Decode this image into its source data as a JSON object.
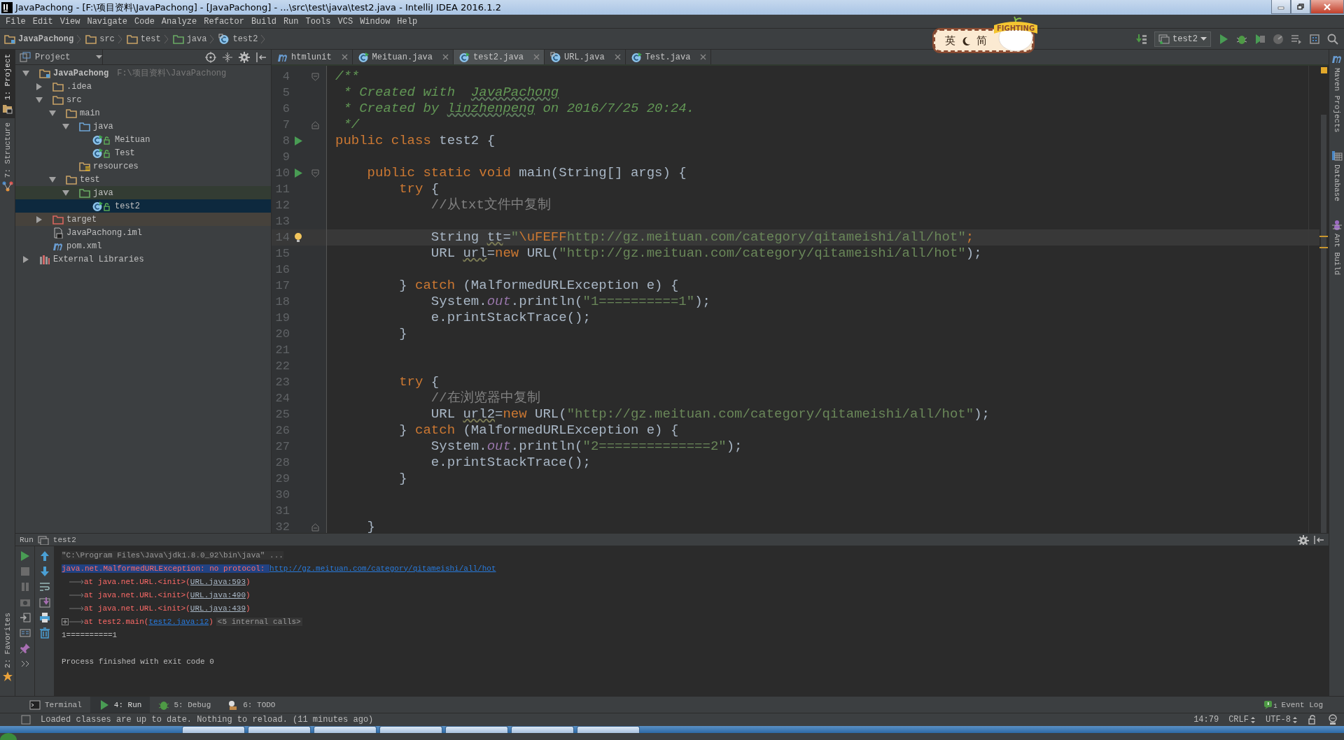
{
  "window": {
    "title": "JavaPachong - [F:\\项目资料\\JavaPachong] - [JavaPachong] - ...\\src\\test\\java\\test2.java - IntelliJ IDEA 2016.1.2"
  },
  "menu": [
    "File",
    "Edit",
    "View",
    "Navigate",
    "Code",
    "Analyze",
    "Refactor",
    "Build",
    "Run",
    "Tools",
    "VCS",
    "Window",
    "Help"
  ],
  "breadcrumbs": [
    {
      "label": "JavaPachong",
      "kind": "project"
    },
    {
      "label": "src",
      "kind": "folder"
    },
    {
      "label": "test",
      "kind": "folder"
    },
    {
      "label": "java",
      "kind": "test-folder"
    },
    {
      "label": "test2",
      "kind": "class"
    }
  ],
  "ime_badge": {
    "language": "英",
    "mode": "简",
    "mascot_text": "FIGHTING"
  },
  "run_config": {
    "label": "test2"
  },
  "left_strip": [
    {
      "label": "1: Project",
      "kind": "project",
      "selected": true
    },
    {
      "label": "7: Structure",
      "kind": "structure",
      "selected": false
    }
  ],
  "favorites_strip": {
    "label": "2: Favorites"
  },
  "right_strip": [
    {
      "label": "Maven Projects",
      "kind": "maven"
    },
    {
      "label": "Database",
      "kind": "database"
    },
    {
      "label": "Ant Build",
      "kind": "ant"
    }
  ],
  "project_panel": {
    "title": "Project",
    "tree": [
      {
        "label": "JavaPachong",
        "note": "F:\\项目资料\\JavaPachong",
        "kind": "project",
        "expanded": true,
        "selected": false,
        "children": [
          {
            "label": ".idea",
            "kind": "folder",
            "expanded": false,
            "selected": false
          },
          {
            "label": "src",
            "kind": "folder",
            "expanded": true,
            "selected": false,
            "children": [
              {
                "label": "main",
                "kind": "folder",
                "expanded": true,
                "selected": false,
                "children": [
                  {
                    "label": "java",
                    "kind": "source-folder",
                    "expanded": true,
                    "selected": false,
                    "children": [
                      {
                        "label": "Meituan",
                        "kind": "class",
                        "selected": false
                      },
                      {
                        "label": "Test",
                        "kind": "class",
                        "selected": false
                      }
                    ]
                  },
                  {
                    "label": "resources",
                    "kind": "resources-folder",
                    "selected": false
                  }
                ]
              },
              {
                "label": "test",
                "kind": "folder",
                "expanded": true,
                "selected": false,
                "children": [
                  {
                    "label": "java",
                    "kind": "test-folder",
                    "expanded": true,
                    "selected": false,
                    "children": [
                      {
                        "label": "test2",
                        "kind": "class",
                        "selected": true
                      }
                    ]
                  }
                ]
              }
            ]
          },
          {
            "label": "target",
            "kind": "excluded-folder",
            "expanded": false,
            "selected": false
          },
          {
            "label": "JavaPachong.iml",
            "kind": "iml",
            "selected": false
          },
          {
            "label": "pom.xml",
            "kind": "maven",
            "selected": false
          }
        ]
      },
      {
        "label": "External Libraries",
        "kind": "libraries",
        "expanded": false,
        "selected": false
      }
    ]
  },
  "tabs": [
    {
      "label": "htmlunit",
      "kind": "maven",
      "selected": false
    },
    {
      "label": "Meituan.java",
      "kind": "class",
      "selected": false
    },
    {
      "label": "test2.java",
      "kind": "class",
      "selected": true
    },
    {
      "label": "URL.java",
      "kind": "library-class",
      "selected": false
    },
    {
      "label": "Test.java",
      "kind": "class",
      "selected": false
    }
  ],
  "editor": {
    "lines": [
      {
        "number": "4",
        "run": false,
        "bulb": false,
        "fold_start": true,
        "fold_end": false,
        "current": false,
        "tokens": [
          {
            "kind": "doc",
            "text": "/**"
          }
        ]
      },
      {
        "number": "5",
        "run": false,
        "bulb": false,
        "fold_start": false,
        "fold_end": false,
        "current": false,
        "tokens": [
          {
            "kind": "doc",
            "text": " * Created with  "
          },
          {
            "kind": "doc-typo",
            "text": "JavaPachong"
          }
        ]
      },
      {
        "number": "6",
        "run": false,
        "bulb": false,
        "fold_start": false,
        "fold_end": false,
        "current": false,
        "tokens": [
          {
            "kind": "doc",
            "text": " * Created by "
          },
          {
            "kind": "doc-typo",
            "text": "linzhenpeng"
          },
          {
            "kind": "doc",
            "text": " on 2016/7/25 20:24."
          }
        ]
      },
      {
        "number": "7",
        "run": false,
        "bulb": false,
        "fold_start": false,
        "fold_end": true,
        "current": false,
        "tokens": [
          {
            "kind": "doc",
            "text": " */"
          }
        ]
      },
      {
        "number": "8",
        "run": true,
        "bulb": false,
        "fold_start": false,
        "fold_end": false,
        "current": false,
        "tokens": [
          {
            "kind": "kw",
            "text": "public class "
          },
          {
            "kind": "plain",
            "text": "test2 {"
          }
        ]
      },
      {
        "number": "9",
        "run": false,
        "bulb": false,
        "fold_start": false,
        "fold_end": false,
        "current": false
      },
      {
        "number": "10",
        "run": true,
        "bulb": false,
        "fold_start": true,
        "fold_end": false,
        "current": false,
        "tokens": [
          {
            "kind": "kw",
            "text": "    public static void "
          },
          {
            "kind": "plain",
            "text": "main(String[] args) {"
          }
        ]
      },
      {
        "number": "11",
        "run": false,
        "bulb": false,
        "fold_start": false,
        "fold_end": false,
        "current": false,
        "tokens": [
          {
            "kind": "kw",
            "text": "        try "
          },
          {
            "kind": "plain",
            "text": "{"
          }
        ]
      },
      {
        "number": "12",
        "run": false,
        "bulb": false,
        "fold_start": false,
        "fold_end": false,
        "current": false,
        "tokens": [
          {
            "kind": "cmt",
            "text": "            //从txt文件中复制"
          }
        ]
      },
      {
        "number": "13",
        "run": false,
        "bulb": false,
        "fold_start": false,
        "fold_end": false,
        "current": false
      },
      {
        "number": "14",
        "run": false,
        "bulb": true,
        "fold_start": false,
        "fold_end": false,
        "current": true,
        "tokens": [
          {
            "kind": "plain",
            "text": "            String "
          },
          {
            "kind": "unused",
            "text": "tt"
          },
          {
            "kind": "plain",
            "text": "="
          },
          {
            "kind": "str",
            "text": "\""
          },
          {
            "kind": "escape",
            "text": "\\uFEFF"
          },
          {
            "kind": "str",
            "text": "http://gz.meituan.com/category/qitameishi/all/hot\""
          },
          {
            "kind": "kw",
            "text": ";"
          }
        ]
      },
      {
        "number": "15",
        "run": false,
        "bulb": false,
        "fold_start": false,
        "fold_end": false,
        "current": false,
        "tokens": [
          {
            "kind": "plain",
            "text": "            URL "
          },
          {
            "kind": "unused",
            "text": "url"
          },
          {
            "kind": "plain",
            "text": "="
          },
          {
            "kind": "kw",
            "text": "new "
          },
          {
            "kind": "plain",
            "text": "URL("
          },
          {
            "kind": "str",
            "text": "\"http://gz.meituan.com/category/qitameishi/all/hot\""
          },
          {
            "kind": "plain",
            "text": ");"
          }
        ]
      },
      {
        "number": "16",
        "run": false,
        "bulb": false,
        "fold_start": false,
        "fold_end": false,
        "current": false
      },
      {
        "number": "17",
        "run": false,
        "bulb": false,
        "fold_start": false,
        "fold_end": false,
        "current": false,
        "tokens": [
          {
            "kind": "plain",
            "text": "        } "
          },
          {
            "kind": "kw",
            "text": "catch "
          },
          {
            "kind": "plain",
            "text": "(MalformedURLException e) {"
          }
        ]
      },
      {
        "number": "18",
        "run": false,
        "bulb": false,
        "fold_start": false,
        "fold_end": false,
        "current": false,
        "tokens": [
          {
            "kind": "plain",
            "text": "            System."
          },
          {
            "kind": "field",
            "text": "out"
          },
          {
            "kind": "plain",
            "text": ".println("
          },
          {
            "kind": "str",
            "text": "\"1==========1\""
          },
          {
            "kind": "plain",
            "text": ");"
          }
        ]
      },
      {
        "number": "19",
        "run": false,
        "bulb": false,
        "fold_start": false,
        "fold_end": false,
        "current": false,
        "tokens": [
          {
            "kind": "plain",
            "text": "            e.printStackTrace();"
          }
        ]
      },
      {
        "number": "20",
        "run": false,
        "bulb": false,
        "fold_start": false,
        "fold_end": false,
        "current": false,
        "tokens": [
          {
            "kind": "plain",
            "text": "        }"
          }
        ]
      },
      {
        "number": "21",
        "run": false,
        "bulb": false,
        "fold_start": false,
        "fold_end": false,
        "current": false
      },
      {
        "number": "22",
        "run": false,
        "bulb": false,
        "fold_start": false,
        "fold_end": false,
        "current": false
      },
      {
        "number": "23",
        "run": false,
        "bulb": false,
        "fold_start": false,
        "fold_end": false,
        "current": false,
        "tokens": [
          {
            "kind": "kw",
            "text": "        try "
          },
          {
            "kind": "plain",
            "text": "{"
          }
        ]
      },
      {
        "number": "24",
        "run": false,
        "bulb": false,
        "fold_start": false,
        "fold_end": false,
        "current": false,
        "tokens": [
          {
            "kind": "cmt",
            "text": "            //在浏览器中复制"
          }
        ]
      },
      {
        "number": "25",
        "run": false,
        "bulb": false,
        "fold_start": false,
        "fold_end": false,
        "current": false,
        "tokens": [
          {
            "kind": "plain",
            "text": "            URL "
          },
          {
            "kind": "unused",
            "text": "url2"
          },
          {
            "kind": "plain",
            "text": "="
          },
          {
            "kind": "kw",
            "text": "new "
          },
          {
            "kind": "plain",
            "text": "URL("
          },
          {
            "kind": "str",
            "text": "\"http://gz.meituan.com/category/qitameishi/all/hot\""
          },
          {
            "kind": "plain",
            "text": ");"
          }
        ]
      },
      {
        "number": "26",
        "run": false,
        "bulb": false,
        "fold_start": false,
        "fold_end": false,
        "current": false,
        "tokens": [
          {
            "kind": "plain",
            "text": "        } "
          },
          {
            "kind": "kw",
            "text": "catch "
          },
          {
            "kind": "plain",
            "text": "(MalformedURLException e) {"
          }
        ]
      },
      {
        "number": "27",
        "run": false,
        "bulb": false,
        "fold_start": false,
        "fold_end": false,
        "current": false,
        "tokens": [
          {
            "kind": "plain",
            "text": "            System."
          },
          {
            "kind": "field",
            "text": "out"
          },
          {
            "kind": "plain",
            "text": ".println("
          },
          {
            "kind": "str",
            "text": "\"2==============2\""
          },
          {
            "kind": "plain",
            "text": ");"
          }
        ]
      },
      {
        "number": "28",
        "run": false,
        "bulb": false,
        "fold_start": false,
        "fold_end": false,
        "current": false,
        "tokens": [
          {
            "kind": "plain",
            "text": "            e.printStackTrace();"
          }
        ]
      },
      {
        "number": "29",
        "run": false,
        "bulb": false,
        "fold_start": false,
        "fold_end": false,
        "current": false,
        "tokens": [
          {
            "kind": "plain",
            "text": "        }"
          }
        ]
      },
      {
        "number": "30",
        "run": false,
        "bulb": false,
        "fold_start": false,
        "fold_end": false,
        "current": false
      },
      {
        "number": "31",
        "run": false,
        "bulb": false,
        "fold_start": false,
        "fold_end": false,
        "current": false
      },
      {
        "number": "32",
        "run": false,
        "bulb": false,
        "fold_start": false,
        "fold_end": true,
        "current": false,
        "tokens": [
          {
            "kind": "plain",
            "text": "    }"
          }
        ]
      }
    ]
  },
  "run_panel": {
    "title": "Run",
    "config": "test2",
    "lines": [
      {
        "kind": "command",
        "segments": [
          {
            "kind": "cmd",
            "text": "\"C:\\Program Files\\Java\\jdk1.8.0_92\\bin\\java\" ..."
          }
        ]
      },
      {
        "kind": "exception",
        "segments": [
          {
            "kind": "error-highlight",
            "text": "java.net.MalformedURLException: no protocol: "
          },
          {
            "kind": "link",
            "text": "http://gz.meituan.com/category/qitameishi/all/hot"
          }
        ]
      },
      {
        "kind": "stack",
        "segments": [
          {
            "kind": "error",
            "text": "at java.net.URL.<init>("
          },
          {
            "kind": "file-link",
            "text": "URL.java:593"
          },
          {
            "kind": "error",
            "text": ")"
          }
        ]
      },
      {
        "kind": "stack",
        "segments": [
          {
            "kind": "error",
            "text": "at java.net.URL.<init>("
          },
          {
            "kind": "file-link",
            "text": "URL.java:490"
          },
          {
            "kind": "error",
            "text": ")"
          }
        ]
      },
      {
        "kind": "stack",
        "segments": [
          {
            "kind": "error",
            "text": "at java.net.URL.<init>("
          },
          {
            "kind": "file-link",
            "text": "URL.java:439"
          },
          {
            "kind": "error",
            "text": ")"
          }
        ]
      },
      {
        "kind": "stack-expandable",
        "segments": [
          {
            "kind": "error",
            "text": "at test2.main("
          },
          {
            "kind": "link",
            "text": "test2.java:12"
          },
          {
            "kind": "error",
            "text": ")"
          },
          {
            "kind": "folded",
            "text": "<5 internal calls>"
          }
        ]
      },
      {
        "kind": "output",
        "segments": [
          {
            "kind": "out",
            "text": "1==========1"
          }
        ]
      },
      {
        "kind": "blank"
      },
      {
        "kind": "output",
        "segments": [
          {
            "kind": "out",
            "text": "Process finished with exit code 0"
          }
        ]
      }
    ]
  },
  "tool_tabs": [
    {
      "label": "Terminal",
      "kind": "terminal",
      "selected": false
    },
    {
      "label": "4: Run",
      "kind": "run",
      "selected": true
    },
    {
      "label": "5: Debug",
      "kind": "debug",
      "selected": false
    },
    {
      "label": "6: TODO",
      "kind": "todo",
      "selected": false
    }
  ],
  "event_log": {
    "label": "Event Log",
    "count": "1"
  },
  "status_bar": {
    "message": "Loaded classes are up to date. Nothing to reload. (11 minutes ago)",
    "position": "14:79",
    "line_separator": "CRLF",
    "encoding": "UTF-8"
  }
}
